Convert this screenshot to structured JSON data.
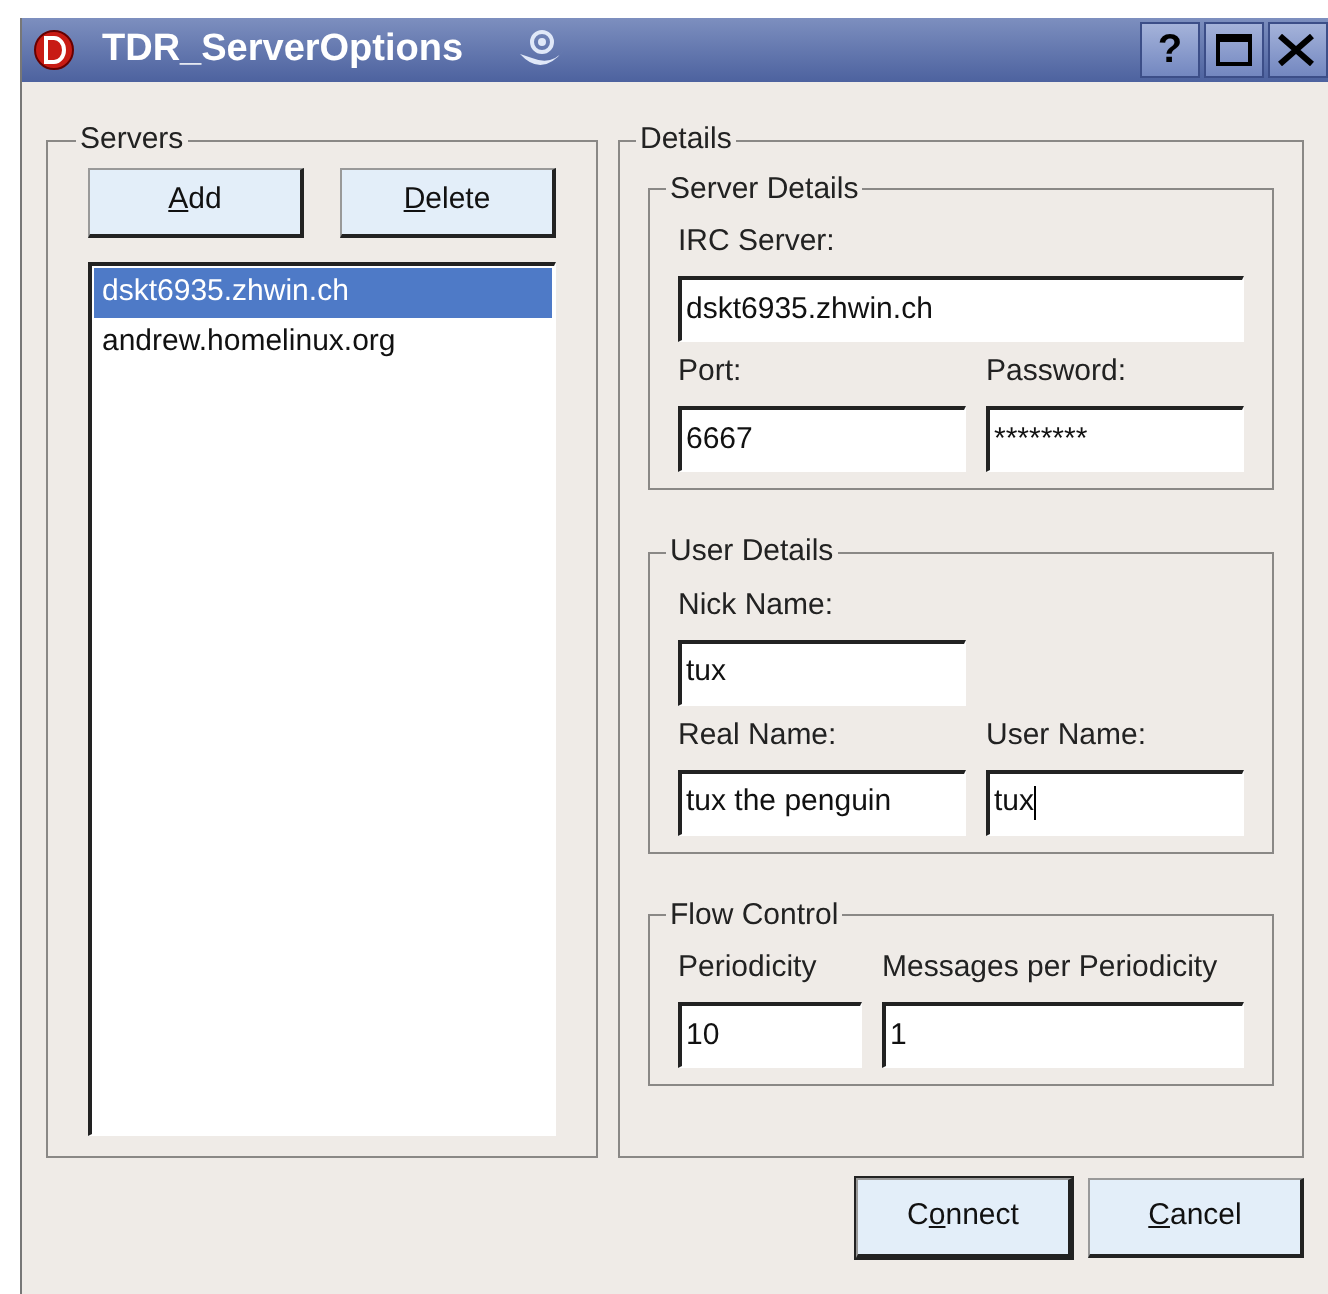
{
  "window": {
    "title": "TDR_ServerOptions",
    "buttons": [
      {
        "kind": "help",
        "label": "?"
      },
      {
        "kind": "maximize"
      },
      {
        "kind": "close"
      }
    ]
  },
  "servers": {
    "title": "Servers",
    "buttons": [
      {
        "mnemonic": "A",
        "after": "dd"
      },
      {
        "mnemonic": "D",
        "after": "elete"
      }
    ],
    "items": [
      {
        "label": "dskt6935.zhwin.ch",
        "selected": true
      },
      {
        "label": "andrew.homelinux.org",
        "selected": false
      }
    ]
  },
  "details": {
    "title": "Details",
    "groups": [
      {
        "kind": "server",
        "title": "Server Details",
        "rows": [
          [
            {
              "label": "IRC Server:",
              "value": "dskt6935.zhwin.ch",
              "focused": false
            }
          ],
          [
            {
              "label": "Port:",
              "value": "6667",
              "focused": false
            },
            {
              "label": "Password:",
              "value": "********",
              "focused": false
            }
          ]
        ]
      },
      {
        "kind": "user",
        "title": "User Details",
        "rows": [
          [
            {
              "label": "Nick Name:",
              "value": "tux",
              "focused": false
            }
          ],
          [
            {
              "label": "Real Name:",
              "value": "tux the penguin",
              "focused": false
            },
            {
              "label": "User Name:",
              "value": "tux",
              "focused": true
            }
          ]
        ]
      },
      {
        "kind": "flow",
        "title": "Flow Control",
        "rows": [
          [
            {
              "label": "Periodicity",
              "value": "10",
              "focused": false
            },
            {
              "label": "Messages per Periodicity",
              "value": "1",
              "focused": false
            }
          ]
        ]
      }
    ]
  },
  "buttons": [
    {
      "before": "C",
      "mnemonic": "o",
      "after": "nnect",
      "default": true
    },
    {
      "mnemonic": "C",
      "after": "ancel",
      "default": false
    }
  ]
}
